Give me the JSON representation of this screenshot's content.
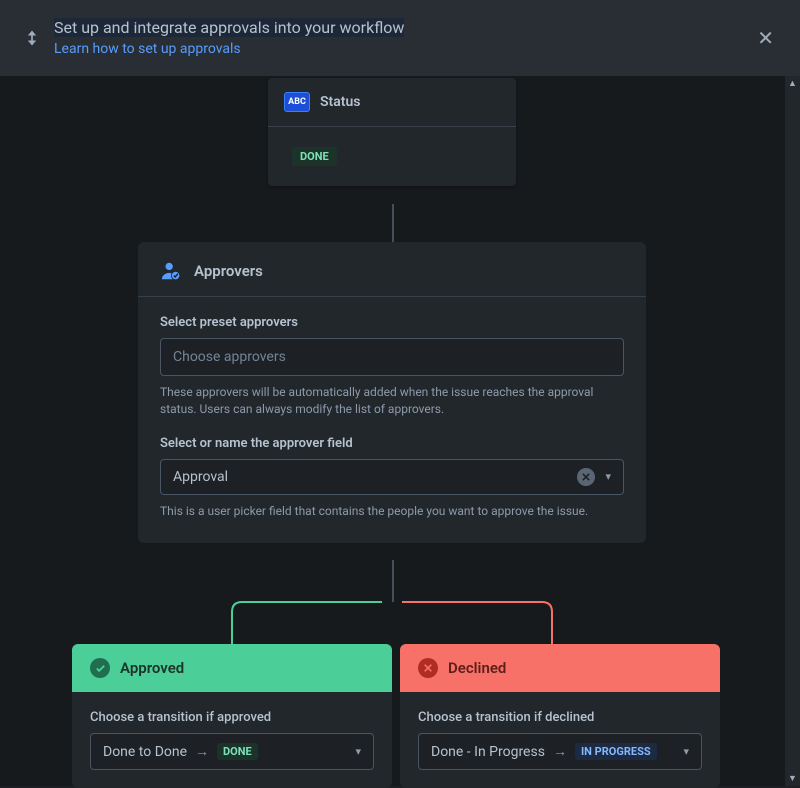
{
  "banner": {
    "title": "Set up and integrate approvals into your workflow",
    "link": "Learn how to set up approvals"
  },
  "status_node": {
    "header_label": "Status",
    "badge_text": "ABC",
    "value": "DONE"
  },
  "approvers": {
    "title": "Approvers",
    "preset_label": "Select preset approvers",
    "preset_placeholder": "Choose approvers",
    "preset_help": "These approvers will be automatically added when the issue reaches the approval status. Users can always modify the list of approvers.",
    "field_label": "Select or name the approver field",
    "field_value": "Approval",
    "field_help": "This is a user picker field that contains the people you want to approve the issue."
  },
  "outcomes": {
    "approved": {
      "title": "Approved",
      "transition_label": "Choose a transition if approved",
      "transition_name": "Done to Done",
      "transition_target": "DONE"
    },
    "declined": {
      "title": "Declined",
      "transition_label": "Choose a transition if declined",
      "transition_name": "Done - In Progress",
      "transition_target": "IN PROGRESS"
    }
  }
}
